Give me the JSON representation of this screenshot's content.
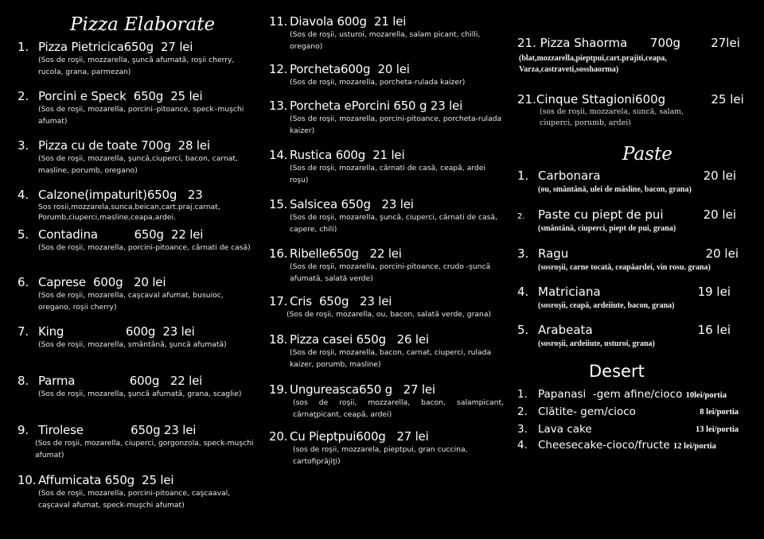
{
  "pizza": {
    "title": "Pizza Elaborate",
    "items": [
      {
        "num": "1.",
        "title": "Pizza Pietricica650g  27 lei",
        "desc": "(Sos de roşii, mozzarella, şuncă afumată, roşii cherry, rucola, grana, parmezan)"
      },
      {
        "num": "2.",
        "title": "Porcini e Speck  650g  25 lei",
        "desc": "(Sos de roşii, mozarella, porcini–pitoance, speck–muşchi afumat)"
      },
      {
        "num": "3.",
        "title": "Pizza cu de toate 700g  28 lei",
        "desc": "(Sos de roşii, mozarella, şuncă,ciuperci, bacon, carnat, masline, porumb, oregano)"
      },
      {
        "num": "4.",
        "title": "Calzone(impaturit)650g   23",
        "desc": "Sos rosii,mozzarela,sunca,beican,cart.praj.carnat, Porumb,ciuperci,masline,ceapa,ardei."
      },
      {
        "num": "5.",
        "title": "Contadina          650g  22 lei",
        "desc": "(Sos de roşii, mozarella, porcini-pitoance, cârnati de casă)"
      },
      {
        "num": "6.",
        "title": "Caprese  600g   20 lei",
        "desc": "(Sos de roşii, mozarella, caşcaval afumat, busuioc, oregano, roşii cherry)"
      },
      {
        "num": "7.",
        "title": "King                 600g  23 lei",
        "desc": "(Sos de roşii, mozarella, smântână, şuncă afumată)"
      },
      {
        "num": "8.",
        "title": "Parma               600g   22 lei",
        "desc": "(Sos de roşii, mozarella, şuncă afumată, grana, scaglie)"
      },
      {
        "num": "9.",
        "title": "Tirolese             650g 23 lei",
        "desc": "(Sos de roşii, mozarella, ciuperci, gorgonzola, speck-muşchi afumat)"
      },
      {
        "num": "10.",
        "title": "Affumicata 650g  25 lei",
        "desc": "(Sos de roşii, mozarella, porcini-pitoance, caşcaaval, caşcaval afumat, speck-muşchi afumat)"
      }
    ]
  },
  "pizza2": {
    "items": [
      {
        "num": "11.",
        "title": "Diavola 600g  21 lei",
        "desc": "(Sos de roşii, usturoi, mozarella, salam picant, chilli, oregano)"
      },
      {
        "num": "12.",
        "title": "Porcheta600g  20 lei",
        "desc": "(Sos de roşii, mozarella, porcheta-rulada kaizer)"
      },
      {
        "num": "13.",
        "title": "Porcheta ePorcini 650 g 23 lei",
        "desc": "(Sos de roşii, mozarella, porcini-pitoance, porcheta-rulada kaizer)"
      },
      {
        "num": "14.",
        "title": "Rustica 600g  21 lei",
        "desc": "(Sos de roşii, mozarella, cârnati de casă, ceapă, ardei roşu)"
      },
      {
        "num": "15.",
        "title": "Salsicea 650g   23 lei",
        "desc": "(Sos de roşii, mozarella, şuncă, ciuperci, cârnati de casă, capere, chili)"
      },
      {
        "num": "16.",
        "title": "Ribelle650g   22 lei",
        "desc": "(Sos de roşii, mozarella, porcini-pitoance, crudo -şuncă afumată, salată verde)"
      },
      {
        "num": "17.",
        "title": "Cris  650g   23 lei",
        "desc": "(Sos de roşii, mozarella, ou, bacon, salată verde, grana)"
      },
      {
        "num": "18.",
        "title": "Pizza casei 650g   26 lei",
        "desc": "(Sos de roşii, mozarella, bacon, carnat, ciuperci, rulada kaizer, porumb, masline)"
      },
      {
        "num": "19.",
        "title": "Ungureasca650 g   27 lei",
        "desc": "(sos  de  roşii,  mozzarella,  bacon,  salampicant, cârnaţpicant, ceapă, ardei)"
      },
      {
        "num": "20.",
        "title": "Cu Pieptpui600g   27 lei",
        "desc": "(sos de roşii, mozzarela, pieptpui, gran cuccina, cartofiprăjiţi)"
      }
    ]
  },
  "specials": {
    "item21": {
      "title": "21. Pizza Shaorma      700g        27lei",
      "desc": "(blat,mozzarella,pieptpui,cart.prajiti,ceapa, Varza,castraveti,sosshaorma)"
    },
    "item21b": {
      "title": "21.Cinque Sttagioni600g            25 lei",
      "desc": "(sos de roşii, mozzarela, suncă, salam, ciuperci, porumb, ardei)"
    }
  },
  "paste": {
    "title": "Paste",
    "items": [
      {
        "num": "1.",
        "title": "Carbonara",
        "price": "20 lei",
        "desc": "(ou, smântână, ulei de măsline, bacon, grana)"
      },
      {
        "num": "2.",
        "title": "Paste cu piept de pui",
        "price": "20 lei",
        "desc": "(smântână, ciuperci, piept de pui, grana)"
      },
      {
        "num": "3.",
        "title": "Ragu",
        "price": "20 lei",
        "desc": "(sosroşii, carne tocată, ceapăardei, vin rosu. grana)"
      },
      {
        "num": "4.",
        "title": "Matriciana",
        "price": "19 lei",
        "desc": "(sosroşii, ceapă, ardeiiute, bacon, grana)"
      },
      {
        "num": "5.",
        "title": "Arabeata",
        "price": "16 lei",
        "desc": "(sosroşii, ardeiiute, usturoi, grana)"
      }
    ]
  },
  "desert": {
    "title": "Desert",
    "items": [
      {
        "num": "1.",
        "title": "Papanasi  -gem afine/cioco ",
        "price": "10lei/portia"
      },
      {
        "num": "2.",
        "title": "Clătite- gem/cioco",
        "price": "8 lei/portia"
      },
      {
        "num": "3.",
        "title": "Lava cake",
        "price": "13 lei/portia"
      },
      {
        "num": "4.",
        "title": "Cheesecake-cioco/fructe ",
        "price": "12 lei/portia"
      }
    ]
  }
}
